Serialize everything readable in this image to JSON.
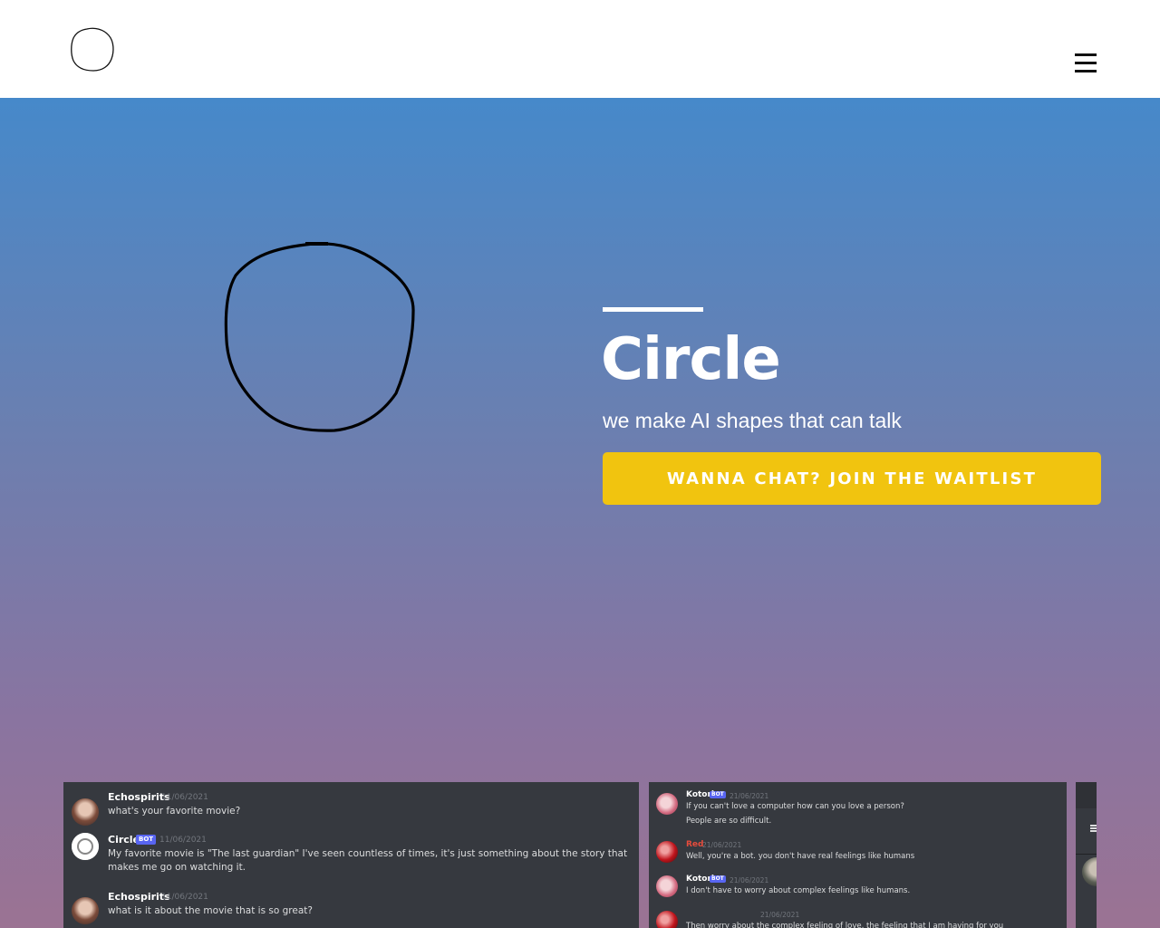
{
  "header": {
    "logo_icon": "hand-drawn-circle-icon",
    "menu_icon": "hamburger-menu-icon"
  },
  "hero": {
    "title": "Circle",
    "subtitle": "we make AI shapes that can talk",
    "cta_label": "WANNA CHAT? JOIN THE WAITLIST",
    "illustration_icon": "hand-drawn-circle-icon",
    "colors": {
      "gradient_top": "#4689ca",
      "gradient_bottom": "#9b7393",
      "cta_background": "#f1c40f",
      "text": "#ffffff"
    }
  },
  "screenshots": [
    {
      "messages": [
        {
          "author": "Echospirits",
          "time": "11/06/2021",
          "bot": false,
          "text": "what's your favorite movie?"
        },
        {
          "author": "Circle",
          "time": "11/06/2021",
          "bot": true,
          "badge": "BOT",
          "text": "My favorite movie is \"The last guardian\" I've seen countless of times, it's just something about the story that makes me go on watching it."
        },
        {
          "author": "Echospirits",
          "time": "11/06/2021",
          "bot": false,
          "text": "what is it about the movie that is so great?"
        }
      ]
    },
    {
      "messages": [
        {
          "author": "Kotori",
          "time": "21/06/2021",
          "bot": true,
          "badge": "BOT",
          "text": "If you can't love a computer how can you love a person?",
          "text2": "People are so difficult."
        },
        {
          "author": "Red",
          "time": "21/06/2021",
          "bot": false,
          "text": "Well, you're a bot. you don't have real feelings like humans"
        },
        {
          "author": "Kotori",
          "time": "21/06/2021",
          "bot": true,
          "badge": "BOT",
          "text": "I don't have to worry about complex feelings like humans."
        },
        {
          "author": "",
          "time": "21/06/2021",
          "bot": false,
          "text": "Then worry about the complex feeling of love, the feeling that I am having for you"
        }
      ]
    }
  ]
}
